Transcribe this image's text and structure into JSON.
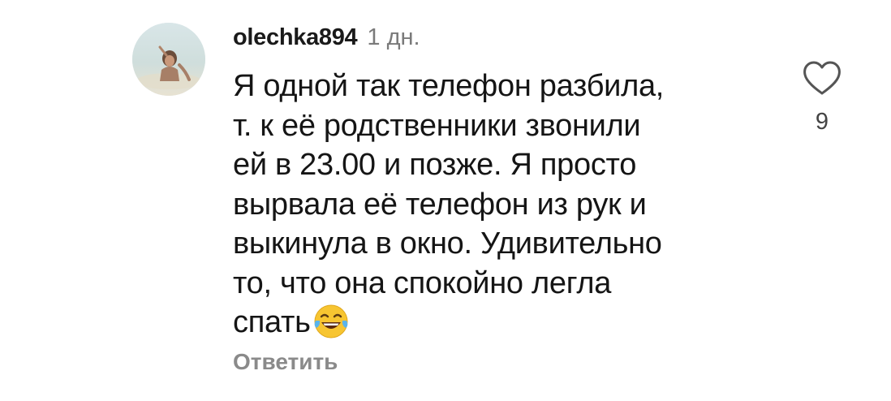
{
  "comment": {
    "username": "olechka894",
    "timestamp": "1 дн.",
    "text_lines": [
      "Я одной так телефон разбила,",
      "т. к её родственники звонили",
      "ей в 23.00 и позже. Я просто",
      "вырвала её телефон из рук и",
      "выкинула в окно. Удивительно",
      "то, что она спокойно легла",
      "спать"
    ],
    "emoji": "face-with-tears-of-joy",
    "reply_label": "Ответить",
    "like_icon": "heart-outline-icon",
    "like_count": "9"
  },
  "colors": {
    "text": "#151515",
    "username": "#1a1a1a",
    "muted": "#7a7a7a",
    "reply": "#8a8a8a",
    "like_count": "#444444"
  }
}
